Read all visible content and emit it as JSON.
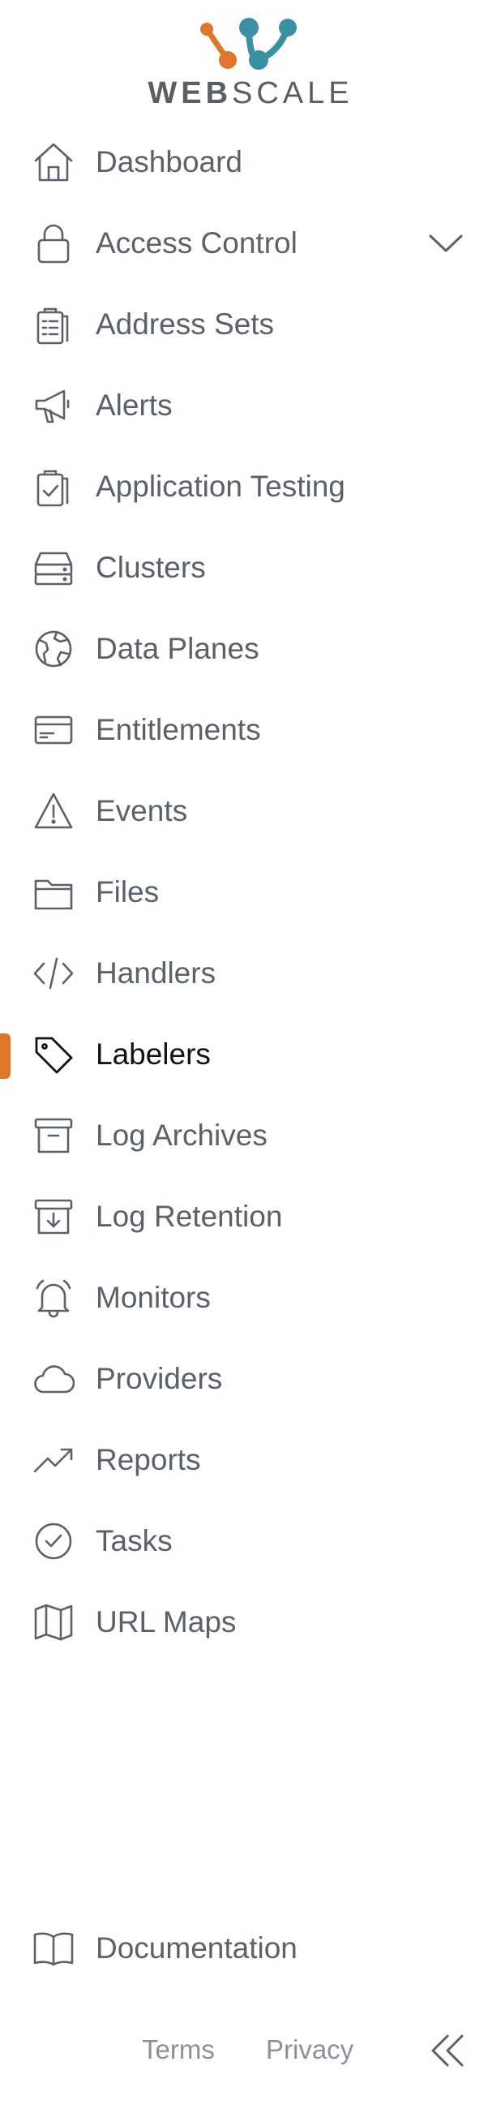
{
  "brand": {
    "name_bold": "WEB",
    "name_light": "SCALE",
    "colors": {
      "orange": "#e0762b",
      "teal": "#3a8fa3",
      "text": "#5a5f66"
    }
  },
  "nav": {
    "items": [
      {
        "label": "Dashboard",
        "icon": "home-icon"
      },
      {
        "label": "Access Control",
        "icon": "lock-icon",
        "expandable": true
      },
      {
        "label": "Address Sets",
        "icon": "clipboard-list-icon"
      },
      {
        "label": "Alerts",
        "icon": "megaphone-icon"
      },
      {
        "label": "Application Testing",
        "icon": "clipboard-check-icon"
      },
      {
        "label": "Clusters",
        "icon": "server-icon"
      },
      {
        "label": "Data Planes",
        "icon": "globe-icon"
      },
      {
        "label": "Entitlements",
        "icon": "credit-card-icon"
      },
      {
        "label": "Events",
        "icon": "warning-icon"
      },
      {
        "label": "Files",
        "icon": "folder-icon"
      },
      {
        "label": "Handlers",
        "icon": "code-icon"
      },
      {
        "label": "Labelers",
        "icon": "tag-icon",
        "active": true
      },
      {
        "label": "Log Archives",
        "icon": "archive-icon"
      },
      {
        "label": "Log Retention",
        "icon": "archive-download-icon"
      },
      {
        "label": "Monitors",
        "icon": "alarm-bell-icon"
      },
      {
        "label": "Providers",
        "icon": "cloud-icon"
      },
      {
        "label": "Reports",
        "icon": "trend-up-icon"
      },
      {
        "label": "Tasks",
        "icon": "check-circle-icon"
      },
      {
        "label": "URL Maps",
        "icon": "map-icon"
      }
    ]
  },
  "documentation": {
    "label": "Documentation",
    "icon": "book-open-icon"
  },
  "footer": {
    "terms": "Terms",
    "privacy": "Privacy",
    "collapse_icon": "chevrons-left-icon"
  },
  "active_accent": "#e0762b"
}
